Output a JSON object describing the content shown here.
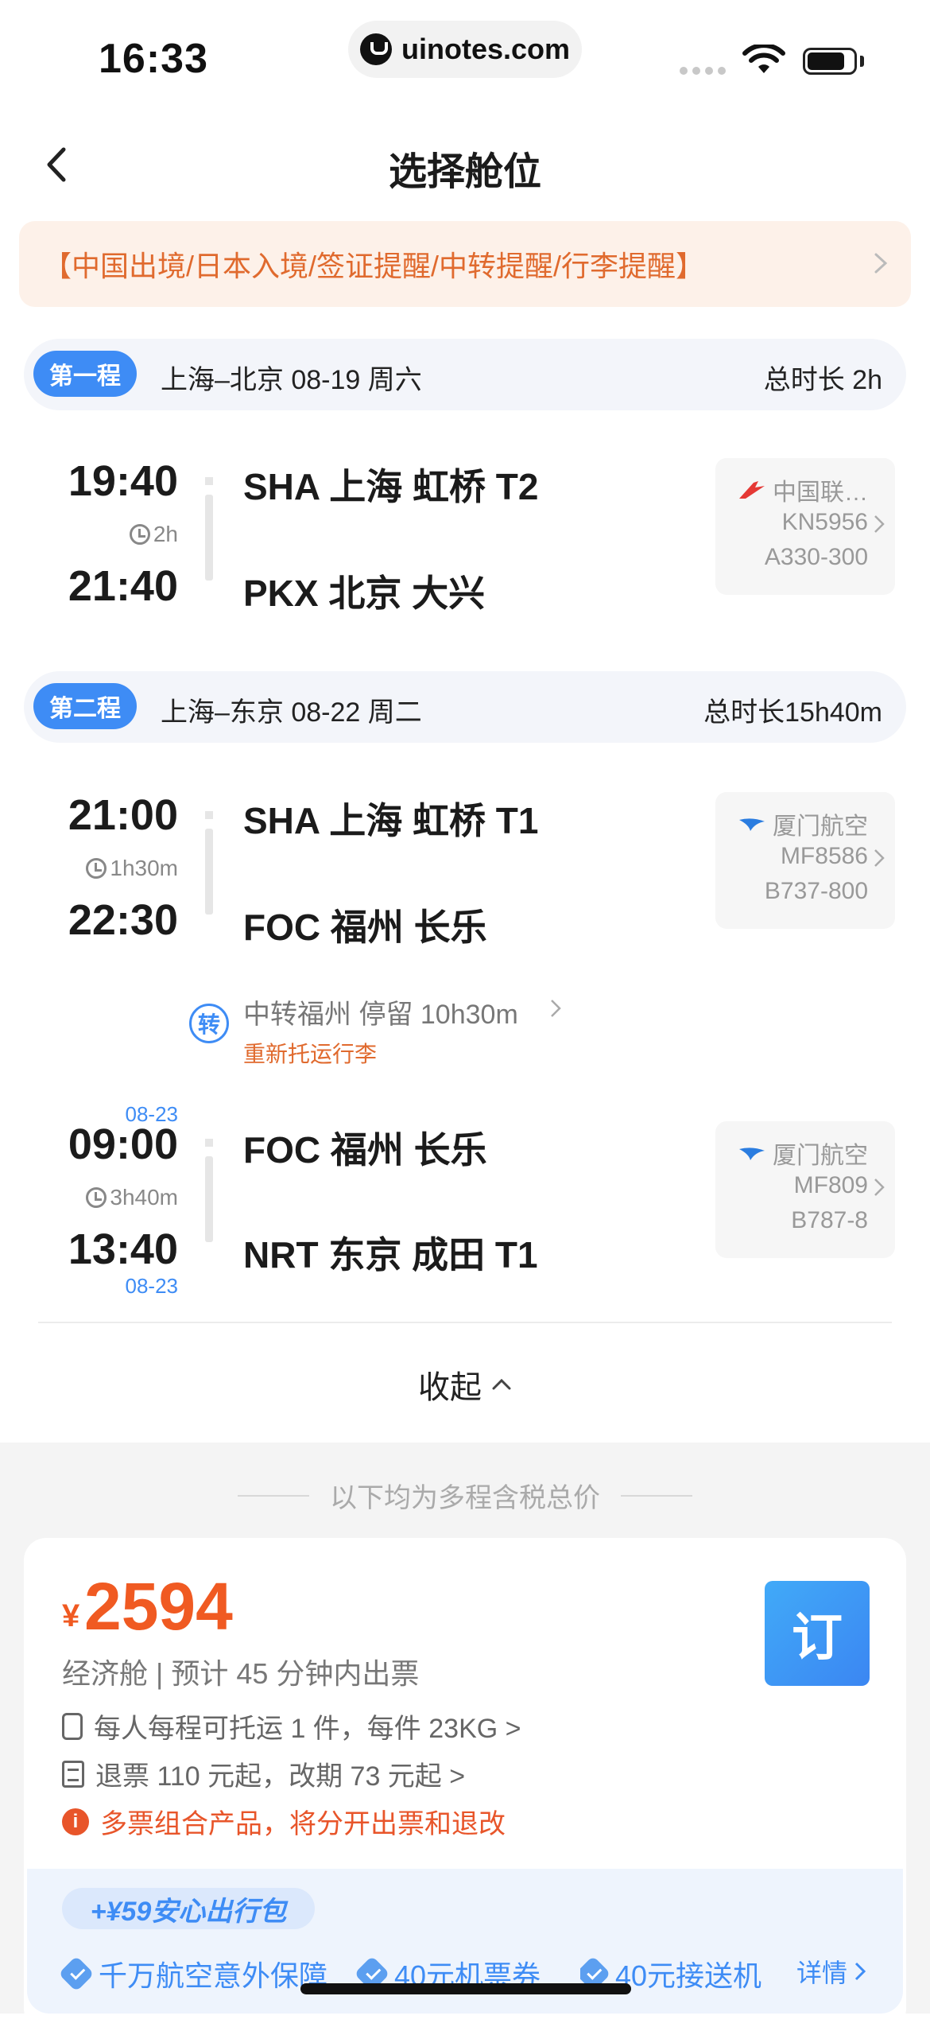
{
  "status_bar": {
    "time": "16:33",
    "url": "uinotes.com"
  },
  "nav": {
    "title": "选择舱位"
  },
  "notice": {
    "text": "【中国出境/日本入境/签证提醒/中转提醒/行李提醒】"
  },
  "legs": [
    {
      "badge": "第一程",
      "route": "上海–北京 08-19 周六",
      "duration": "总时长 2h",
      "segments": [
        {
          "dep_time": "19:40",
          "arr_time": "21:40",
          "duration": "2h",
          "dep_airport": "SHA 上海 虹桥 T2",
          "arr_airport": "PKX 北京 大兴",
          "airline": "中国联…",
          "flight_no": "KN5956",
          "aircraft": "A330-300"
        }
      ]
    },
    {
      "badge": "第二程",
      "route": "上海–东京 08-22 周二",
      "duration": "总时长15h40m",
      "segments": [
        {
          "dep_time": "21:00",
          "arr_time": "22:30",
          "duration": "1h30m",
          "dep_airport": "SHA 上海 虹桥 T1",
          "arr_airport": "FOC 福州 长乐",
          "airline": "厦门航空",
          "flight_no": "MF8586",
          "aircraft": "B737-800"
        },
        {
          "dep_date": "08-23",
          "arr_date": "08-23",
          "dep_time": "09:00",
          "arr_time": "13:40",
          "duration": "3h40m",
          "dep_airport": "FOC 福州 长乐",
          "arr_airport": "NRT 东京 成田 T1",
          "airline": "厦门航空",
          "flight_no": "MF809",
          "aircraft": "B787-8"
        }
      ],
      "transfer": {
        "icon_label": "转",
        "text": "中转福州 停留 10h30m",
        "note": "重新托运行李"
      }
    }
  ],
  "collapse_label": "收起",
  "price_caption": "以下均为多程含税总价",
  "offer": {
    "currency": "¥",
    "price": "2594",
    "cabin": "经济舱 | 预计 45 分钟内出票",
    "baggage": "每人每程可托运 1 件，每件 23KG >",
    "refund": "退票 110 元起，改期 73 元起 >",
    "warning_icon": "i",
    "warning": "多票组合产品，将分开出票和退改",
    "book_label": "订"
  },
  "package": {
    "badge": "+¥59安心出行包",
    "perks": [
      "千万航空意外保障",
      "40元机票券",
      "40元接送机"
    ],
    "details_label": "详情"
  },
  "colors": {
    "accent": "#3e8cf5",
    "price": "#f05a22",
    "warning": "#e8552a"
  }
}
